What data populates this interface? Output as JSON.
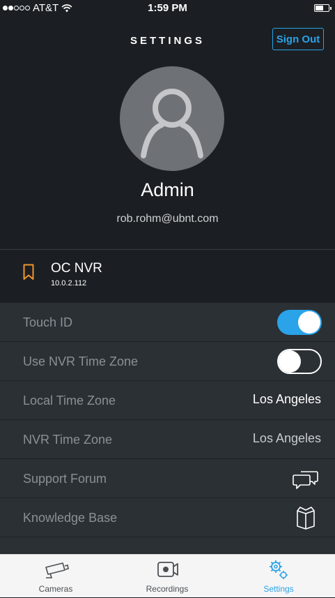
{
  "status_bar": {
    "carrier": "AT&T",
    "time": "1:59 PM",
    "battery_level": 0.6
  },
  "header": {
    "title": "SETTINGS",
    "signout_label": "Sign Out"
  },
  "profile": {
    "name": "Admin",
    "email": "rob.rohm@ubnt.com"
  },
  "nvr": {
    "name": "OC NVR",
    "ip": "10.0.2.112"
  },
  "settings": [
    {
      "label": "Touch ID",
      "type": "toggle",
      "on": true
    },
    {
      "label": "Use NVR Time Zone",
      "type": "toggle",
      "on": false
    },
    {
      "label": "Local Time Zone",
      "type": "value",
      "value": "Los Angeles"
    },
    {
      "label": "NVR Time Zone",
      "type": "value",
      "value": "Los Angeles"
    },
    {
      "label": "Support Forum",
      "type": "icon",
      "icon": "chat-bubbles-icon"
    },
    {
      "label": "Knowledge Base",
      "type": "icon",
      "icon": "book-icon"
    }
  ],
  "tabs": [
    {
      "label": "Cameras",
      "icon": "camera-icon",
      "active": false
    },
    {
      "label": "Recordings",
      "icon": "video-recording-icon",
      "active": false
    },
    {
      "label": "Settings",
      "icon": "gears-icon",
      "active": true
    }
  ],
  "colors": {
    "accent": "#2aa3e8",
    "nvr_icon": "#f0952a",
    "background": "#1b1f23",
    "list_bg": "#2b3035"
  }
}
